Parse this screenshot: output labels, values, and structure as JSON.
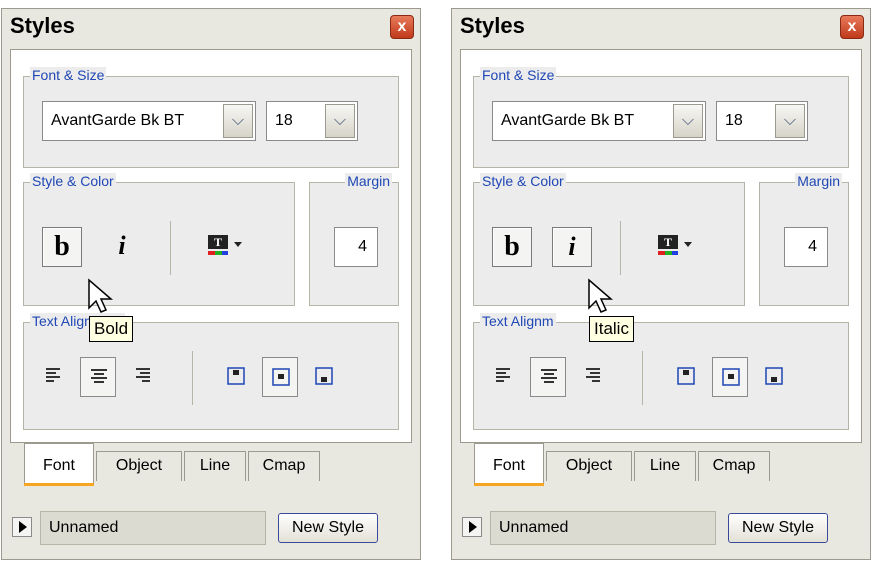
{
  "panels": [
    {
      "title": "Styles",
      "close_label": "x",
      "font_size_group": "Font & Size",
      "font_name": "AvantGarde Bk BT",
      "font_size": "18",
      "style_color_group": "Style & Color",
      "margin_group": "Margin",
      "bold_label": "b",
      "italic_label": "i",
      "margin_value": "4",
      "text_alignment_group": "Text Alignment",
      "tooltip": "Bold",
      "tabs": [
        "Font",
        "Object",
        "Line",
        "Cmap"
      ],
      "active_tab": "Font",
      "style_name": "Unnamed",
      "new_style_label": "New Style",
      "pressed": "bold"
    },
    {
      "title": "Styles",
      "close_label": "x",
      "font_size_group": "Font & Size",
      "font_name": "AvantGarde Bk BT",
      "font_size": "18",
      "style_color_group": "Style & Color",
      "margin_group": "Margin",
      "bold_label": "b",
      "italic_label": "i",
      "margin_value": "4",
      "text_alignment_group": "Text Alignm",
      "tooltip": "Italic",
      "tabs": [
        "Font",
        "Object",
        "Line",
        "Cmap"
      ],
      "active_tab": "Font",
      "style_name": "Unnamed",
      "new_style_label": "New Style",
      "pressed": "italic"
    }
  ],
  "colors": {
    "accent_blue": "#1f47b5",
    "tab_underline": "#f5a623",
    "close_red": "#c0391b",
    "tooltip_bg": "#ffffe1"
  },
  "icons": [
    "close-icon",
    "chevron-down-icon",
    "text-color-icon",
    "align-left-icon",
    "align-center-icon",
    "align-right-icon",
    "valign-top-icon",
    "valign-middle-icon",
    "valign-bottom-icon",
    "play-icon",
    "cursor-icon"
  ]
}
